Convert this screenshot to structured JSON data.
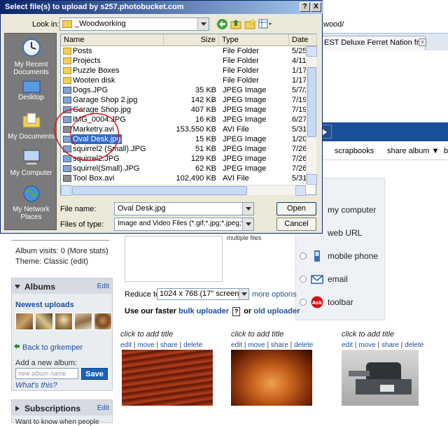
{
  "dialog": {
    "title": "Select file(s) to upload by s257.photobucket.com",
    "help_btn": "?",
    "close_btn": "X",
    "look_in_label": "Look in:",
    "look_in_value": "_Woodworking",
    "places": [
      {
        "label": "My Recent Documents"
      },
      {
        "label": "Desktop"
      },
      {
        "label": "My Documents"
      },
      {
        "label": "My Computer"
      },
      {
        "label": "My Network Places"
      }
    ],
    "columns": {
      "name": "Name",
      "size": "Size",
      "type": "Type",
      "date": "Date"
    },
    "files": [
      {
        "name": "Posts",
        "size": "",
        "type": "File Folder",
        "date": "5/25/2",
        "kind": "folder"
      },
      {
        "name": "Projects",
        "size": "",
        "type": "File Folder",
        "date": "4/11/2",
        "kind": "folder"
      },
      {
        "name": "Puzzle Boxes",
        "size": "",
        "type": "File Folder",
        "date": "1/17/2",
        "kind": "folder"
      },
      {
        "name": "Wooten disk",
        "size": "",
        "type": "File Folder",
        "date": "1/17/2",
        "kind": "folder"
      },
      {
        "name": "Dogs.JPG",
        "size": "35 KB",
        "type": "JPEG Image",
        "date": "5/7/20",
        "kind": "image"
      },
      {
        "name": "Garage Shop 2.jpg",
        "size": "142 KB",
        "type": "JPEG Image",
        "date": "7/19/2",
        "kind": "image"
      },
      {
        "name": "Garage Shop.jpg",
        "size": "407 KB",
        "type": "JPEG Image",
        "date": "7/19/2",
        "kind": "image"
      },
      {
        "name": "IMG_0004.JPG",
        "size": "16 KB",
        "type": "JPEG Image",
        "date": "6/27/2",
        "kind": "image"
      },
      {
        "name": "Marketry.avi",
        "size": "153,550 KB",
        "type": "AVI File",
        "date": "5/31/2",
        "kind": "video"
      },
      {
        "name": "Oval Desk.jpg",
        "size": "15 KB",
        "type": "JPEG Image",
        "date": "1/20/2",
        "kind": "image",
        "selected": true
      },
      {
        "name": "squirrel2 (Small).JPG",
        "size": "51 KB",
        "type": "JPEG Image",
        "date": "7/26/2",
        "kind": "image"
      },
      {
        "name": "squirrel2.JPG",
        "size": "129 KB",
        "type": "JPEG Image",
        "date": "7/26/2",
        "kind": "image"
      },
      {
        "name": "squirrel(Small).JPG",
        "size": "62 KB",
        "type": "JPEG Image",
        "date": "7/26/2",
        "kind": "image"
      },
      {
        "name": "Tool Box.avi",
        "size": "102,490 KB",
        "type": "AVI File",
        "date": "5/31/2",
        "kind": "video"
      }
    ],
    "file_name_label": "File name:",
    "file_name_value": "Oval Desk.jpg",
    "file_type_label": "Files of type:",
    "file_type_value": "Image and Video Files (*.gif;*.jpg;*.jpeg;*.png;*.b",
    "open_label": "Open",
    "cancel_label": "Cancel"
  },
  "browser": {
    "address_fragment": "wood/",
    "tab_title": "EST Deluxe Ferret Nation from Ki...",
    "tab_close": "×"
  },
  "subnav": [
    "scrapbooks",
    "share album ▼"
  ],
  "upload_methods": [
    "my computer",
    "web URL",
    "mobile phone",
    "email",
    "toolbar"
  ],
  "upload_form": {
    "multiple_files": "multiple files",
    "reduce_label": "Reduce to:",
    "reduce_value": "1024 x 768 (17\" screen)",
    "more_options": "more options",
    "faster_prefix": "Use our faster",
    "bulk_uploader": "bulk uploader",
    "qmark": "?",
    "or_text": "or",
    "old_uploader": "old uploader"
  },
  "sidebar": {
    "album_visits": "Album visits: 0 (More stats)",
    "theme": "Theme: Classic (edit)",
    "albums_title": "Albums",
    "albums_edit": "Edit",
    "newest_uploads": "Newest uploads",
    "back_link": "Back to grkemper",
    "add_album_label": "Add a new album:",
    "new_album_placeholder": "new album name",
    "save_label": "Save",
    "whats_this": "What's this?",
    "subscriptions_title": "Subscriptions",
    "subscriptions_edit": "Edit",
    "want_know": "Want to know when people"
  },
  "photos": [
    {
      "title": "click to add title",
      "actions": [
        "edit",
        "move",
        "share",
        "delete"
      ]
    },
    {
      "title": "click to add title",
      "actions": [
        "edit",
        "move",
        "share",
        "delete"
      ]
    },
    {
      "title": "click to add title",
      "actions": [
        "edit",
        "move",
        "share",
        "delete"
      ]
    }
  ],
  "colors": {
    "title_gradient_start": "#0a246a",
    "title_gradient_end": "#a6caf0",
    "selection": "#316ac5",
    "nav_blue": "#1a4f9a",
    "annotation_red": "#d42020"
  }
}
